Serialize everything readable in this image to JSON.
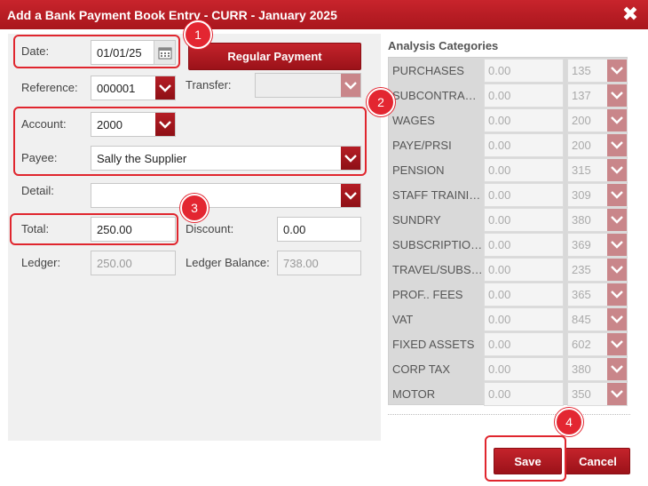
{
  "window": {
    "title": "Add a Bank Payment Book Entry - CURR - January 2025",
    "close_symbol": "✖"
  },
  "form": {
    "date_label": "Date:",
    "date_value": "01/01/25",
    "reference_label": "Reference:",
    "reference_value": "000001",
    "regular_payment_label": "Regular Payment",
    "transfer_label": "Transfer:",
    "transfer_value": "",
    "account_label": "Account:",
    "account_value": "2000",
    "payee_label": "Payee:",
    "payee_value": "Sally the Supplier",
    "detail_label": "Detail:",
    "detail_value": "",
    "total_label": "Total:",
    "total_value": "250.00",
    "discount_label": "Discount:",
    "discount_value": "0.00",
    "ledger_label": "Ledger:",
    "ledger_value": "250.00",
    "ledger_balance_label": "Ledger Balance:",
    "ledger_balance_value": "738.00"
  },
  "analysis": {
    "title": "Analysis Categories",
    "rows": [
      {
        "name": "PURCHASES",
        "amount": "0.00",
        "code": "135"
      },
      {
        "name": "SUBCONTRA…",
        "amount": "0.00",
        "code": "137"
      },
      {
        "name": "WAGES",
        "amount": "0.00",
        "code": "200"
      },
      {
        "name": "PAYE/PRSI",
        "amount": "0.00",
        "code": "200"
      },
      {
        "name": "PENSION",
        "amount": "0.00",
        "code": "315"
      },
      {
        "name": "STAFF TRAINI…",
        "amount": "0.00",
        "code": "309"
      },
      {
        "name": "SUNDRY",
        "amount": "0.00",
        "code": "380"
      },
      {
        "name": "SUBSCRIPTIO…",
        "amount": "0.00",
        "code": "369"
      },
      {
        "name": "TRAVEL/SUBS…",
        "amount": "0.00",
        "code": "235"
      },
      {
        "name": "PROF.. FEES",
        "amount": "0.00",
        "code": "365"
      },
      {
        "name": "VAT",
        "amount": "0.00",
        "code": "845"
      },
      {
        "name": "FIXED ASSETS",
        "amount": "0.00",
        "code": "602"
      },
      {
        "name": "CORP TAX",
        "amount": "0.00",
        "code": "380"
      },
      {
        "name": "MOTOR",
        "amount": "0.00",
        "code": "350"
      }
    ]
  },
  "actions": {
    "save_label": "Save",
    "cancel_label": "Cancel"
  },
  "callouts": {
    "badge1": "1",
    "badge2": "2",
    "badge3": "3",
    "badge4": "4"
  },
  "icons": {
    "close": "close-icon",
    "calendar": "calendar-icon",
    "dropdown": "chevron-down-icon"
  },
  "colors": {
    "brand_red": "#b51d25",
    "callout_red": "#e32631",
    "panel_bg": "#f0f0f0"
  }
}
